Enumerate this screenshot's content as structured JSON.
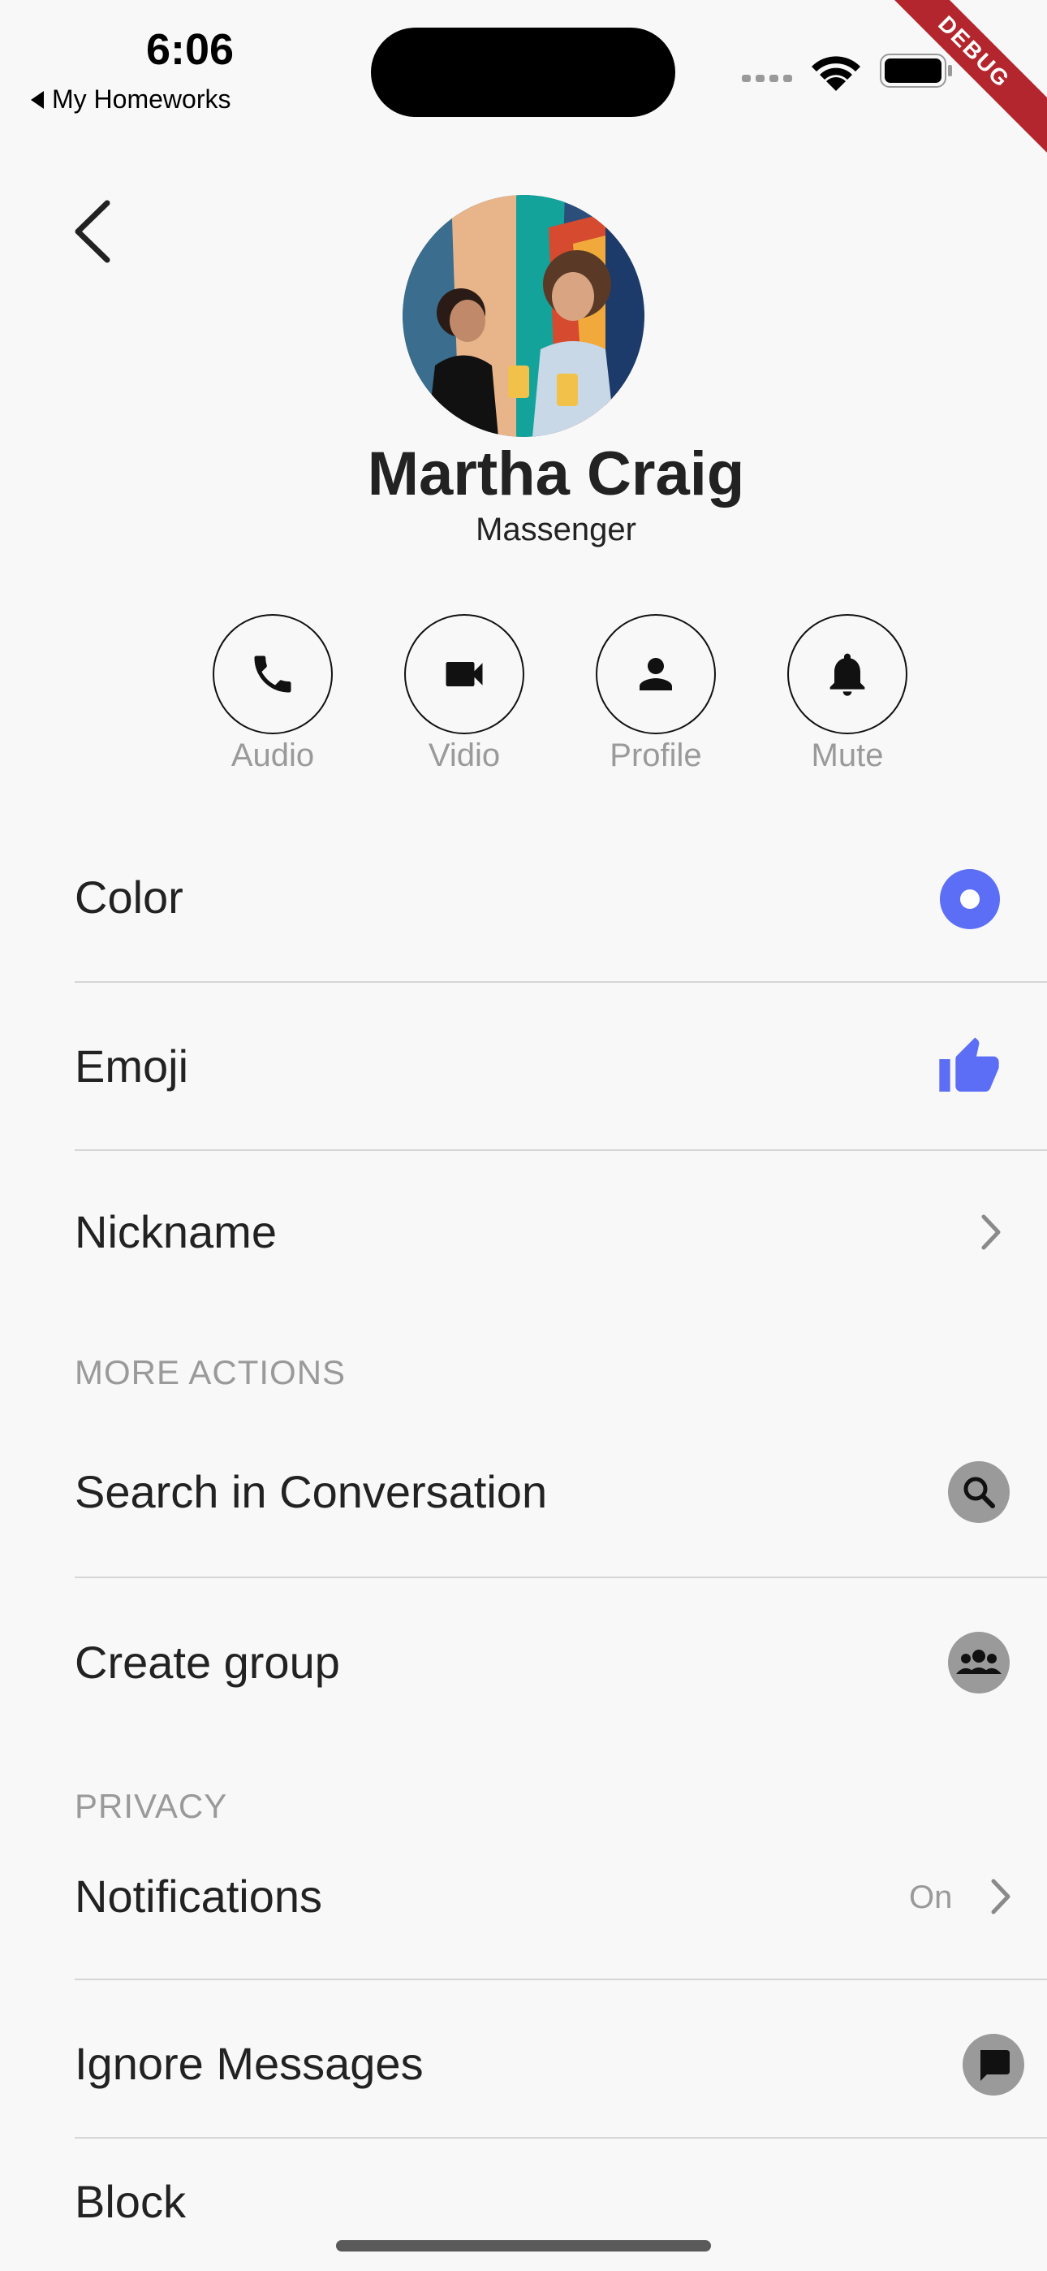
{
  "status_bar": {
    "time": "6:06",
    "back_app": "My Homeworks",
    "debug_banner": "DEBUG"
  },
  "profile": {
    "name": "Martha Craig",
    "subtitle": "Massenger"
  },
  "actions": [
    {
      "label": "Audio",
      "icon": "phone-icon"
    },
    {
      "label": "Vidio",
      "icon": "video-icon"
    },
    {
      "label": "Profile",
      "icon": "person-icon"
    },
    {
      "label": "Mute",
      "icon": "bell-icon"
    }
  ],
  "settings": {
    "color_label": "Color",
    "emoji_label": "Emoji",
    "nickname_label": "Nickname"
  },
  "more_actions": {
    "header": "MORE ACTIONS",
    "search_label": "Search in Conversation",
    "create_group_label": "Create group"
  },
  "privacy": {
    "header": "PRIVACY",
    "notifications_label": "Notifications",
    "notifications_value": "On",
    "ignore_label": "Ignore Messages",
    "block_label": "Block"
  },
  "colors": {
    "accent": "#5b6ef5",
    "muted": "#9a9a9a",
    "debug": "#b3262d"
  }
}
